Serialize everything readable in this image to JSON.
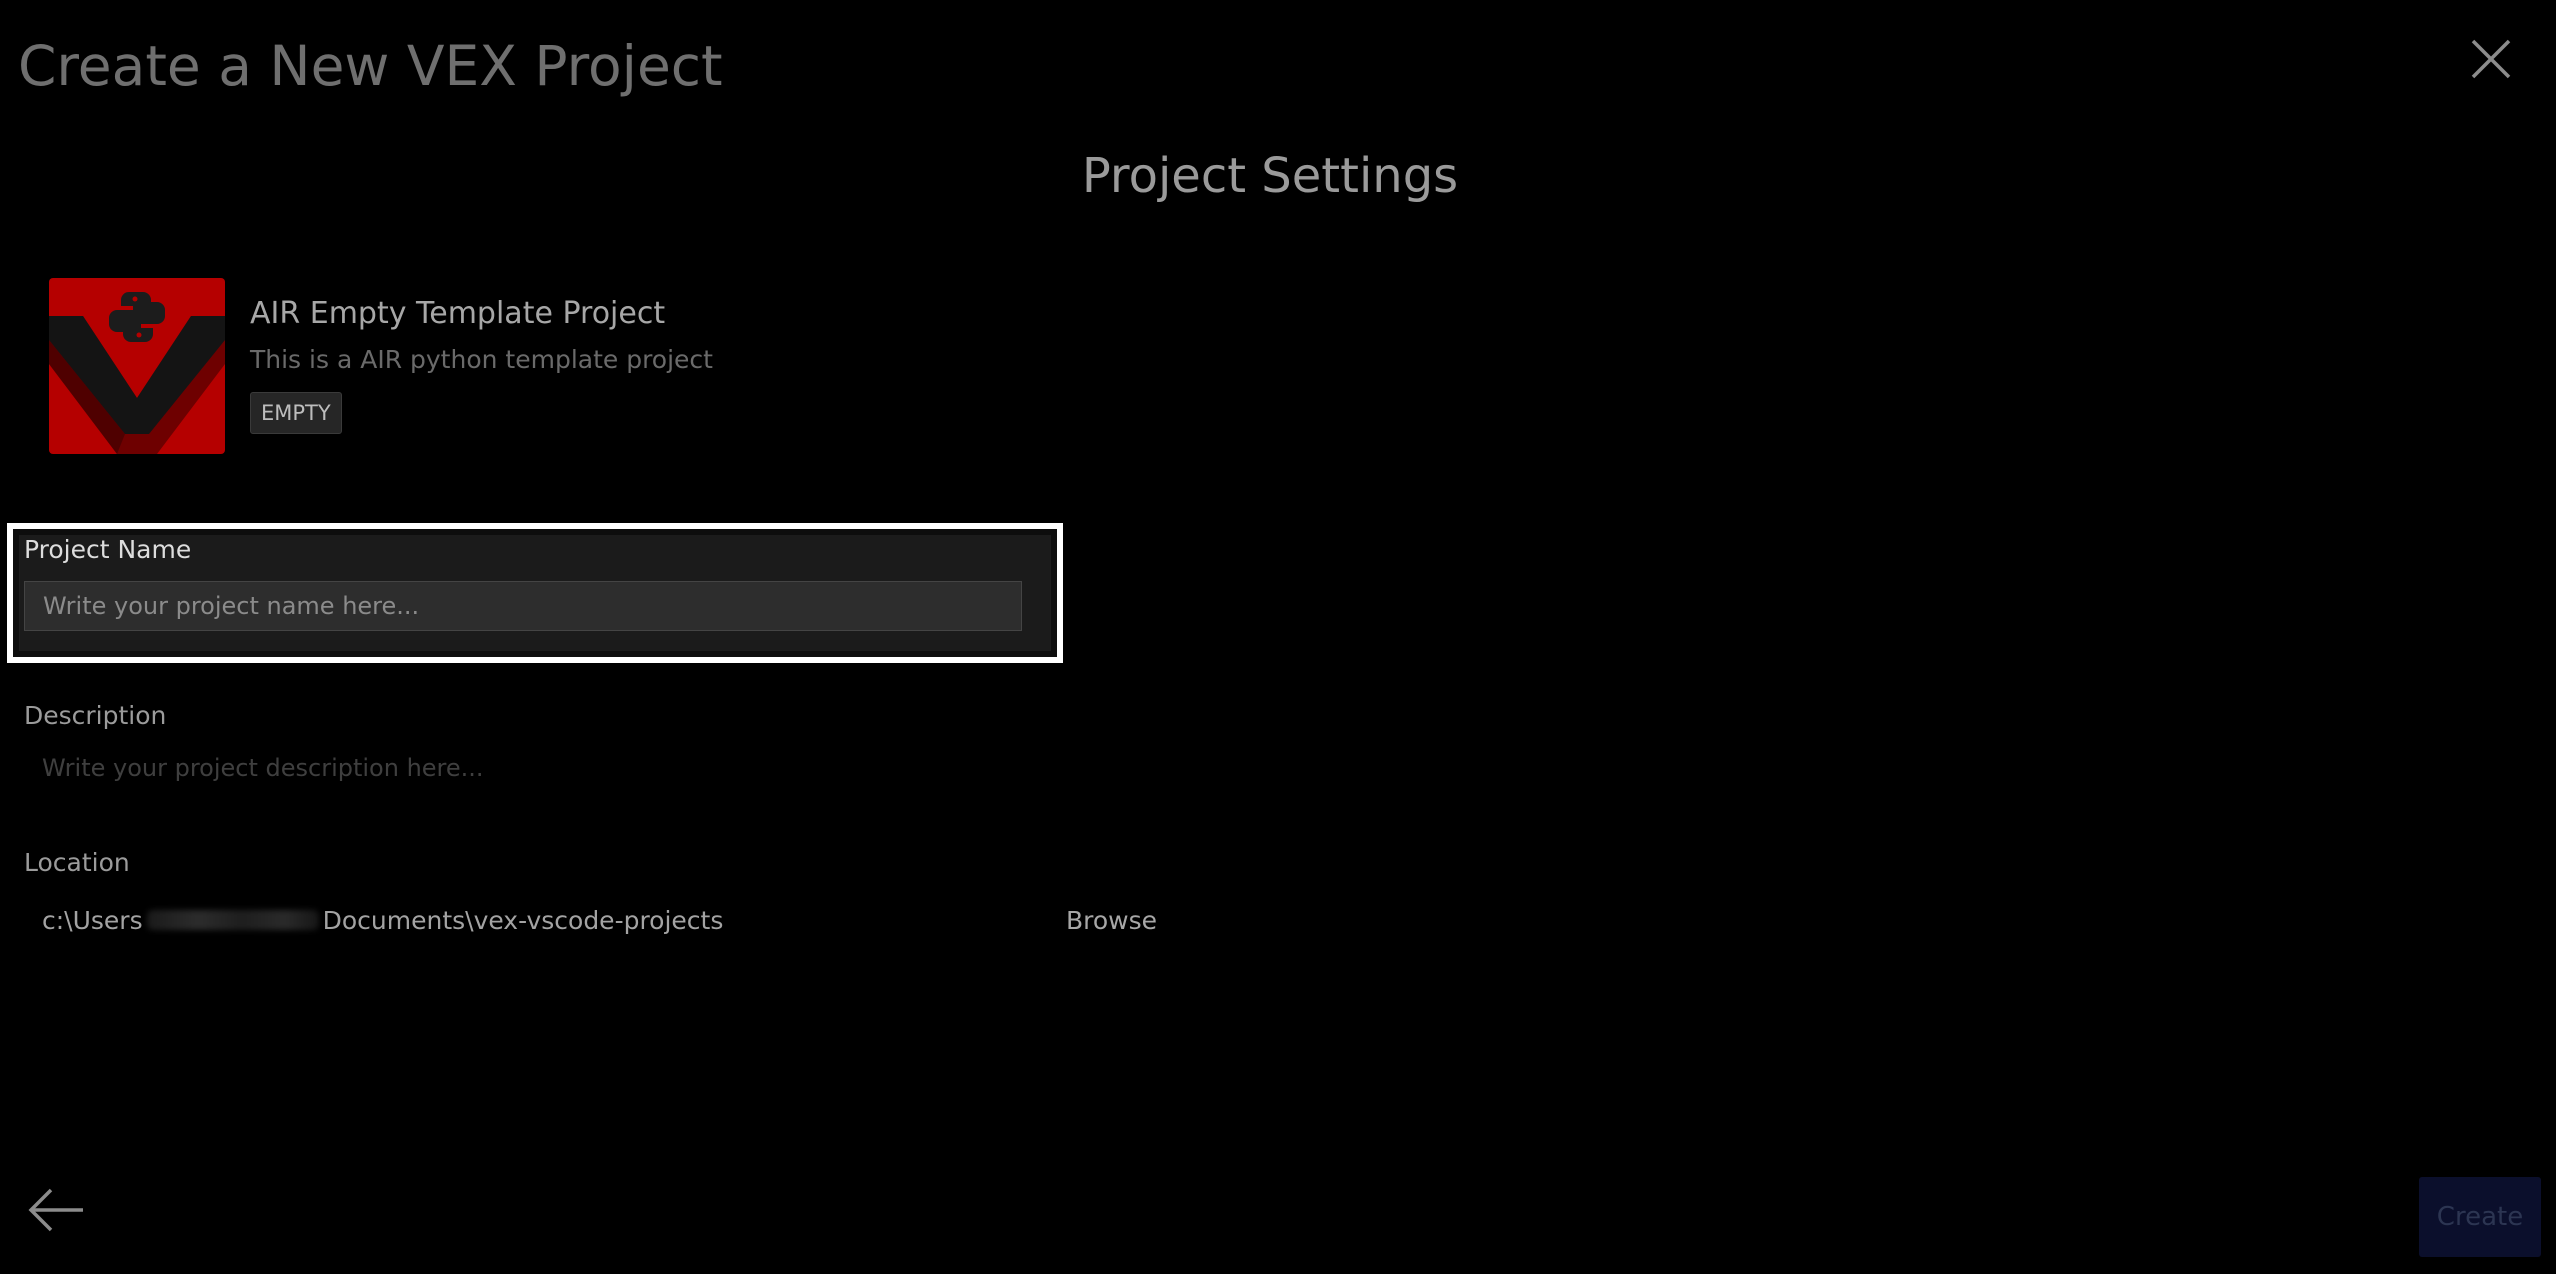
{
  "dialog": {
    "title": "Create a New VEX Project",
    "section_title": "Project Settings"
  },
  "template": {
    "logo_icon": "vex-python-logo-icon",
    "name": "AIR Empty Template Project",
    "description": "This is a AIR python template project",
    "badge": "EMPTY"
  },
  "form": {
    "project_name": {
      "label": "Project Name",
      "value": "",
      "placeholder": "Write your project name here..."
    },
    "description": {
      "label": "Description",
      "value": "",
      "placeholder": "Write your project description here..."
    },
    "location": {
      "label": "Location",
      "path_prefix": "c:\\Users",
      "path_suffix": "Documents\\vex-vscode-projects",
      "browse_label": "Browse"
    }
  },
  "footer": {
    "back_icon": "arrow-left-icon",
    "create_label": "Create"
  },
  "colors": {
    "background": "#000000",
    "logo_red": "#b50000",
    "highlight_border": "#ffffff",
    "create_button_bg": "#0b0f2c"
  }
}
